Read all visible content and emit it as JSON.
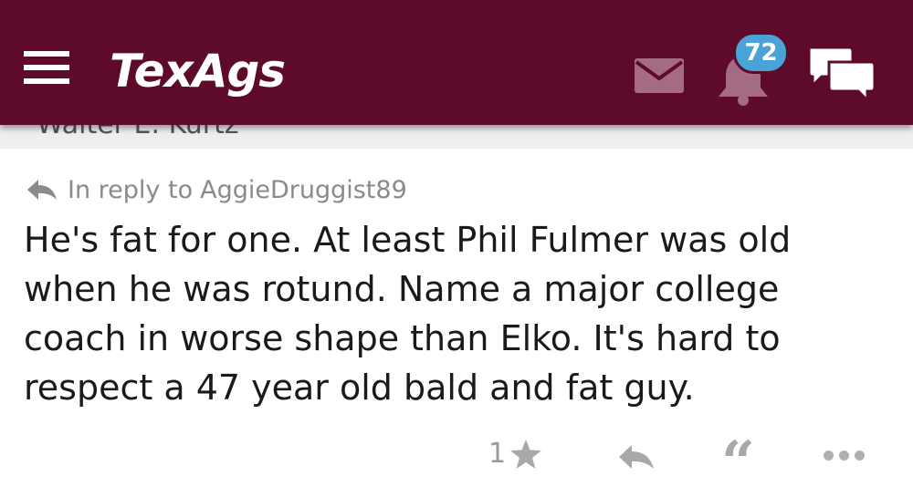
{
  "header": {
    "logo_text": "TexAgs",
    "notification_count": "72",
    "colors": {
      "bar": "#5e0a2a",
      "badge": "#4aa3d6"
    }
  },
  "partial_header_text": "Walter E. Kurtz",
  "post": {
    "reply_to_prefix": "In reply to",
    "reply_to_user": "AggieDruggist89",
    "body": "He's fat for one. At least Phil Fulmer was old when he was rotund. Name a major college coach in worse shape than Elko. It's hard to respect a 47 year old bald and fat guy.",
    "like_count": "1"
  },
  "icons": {
    "menu": "hamburger-icon",
    "mail": "mail-icon",
    "bell": "bell-icon",
    "chat": "chat-icon",
    "reply": "reply-arrow-icon",
    "star": "star-icon",
    "quote": "quote-icon",
    "more": "more-dots-icon"
  }
}
